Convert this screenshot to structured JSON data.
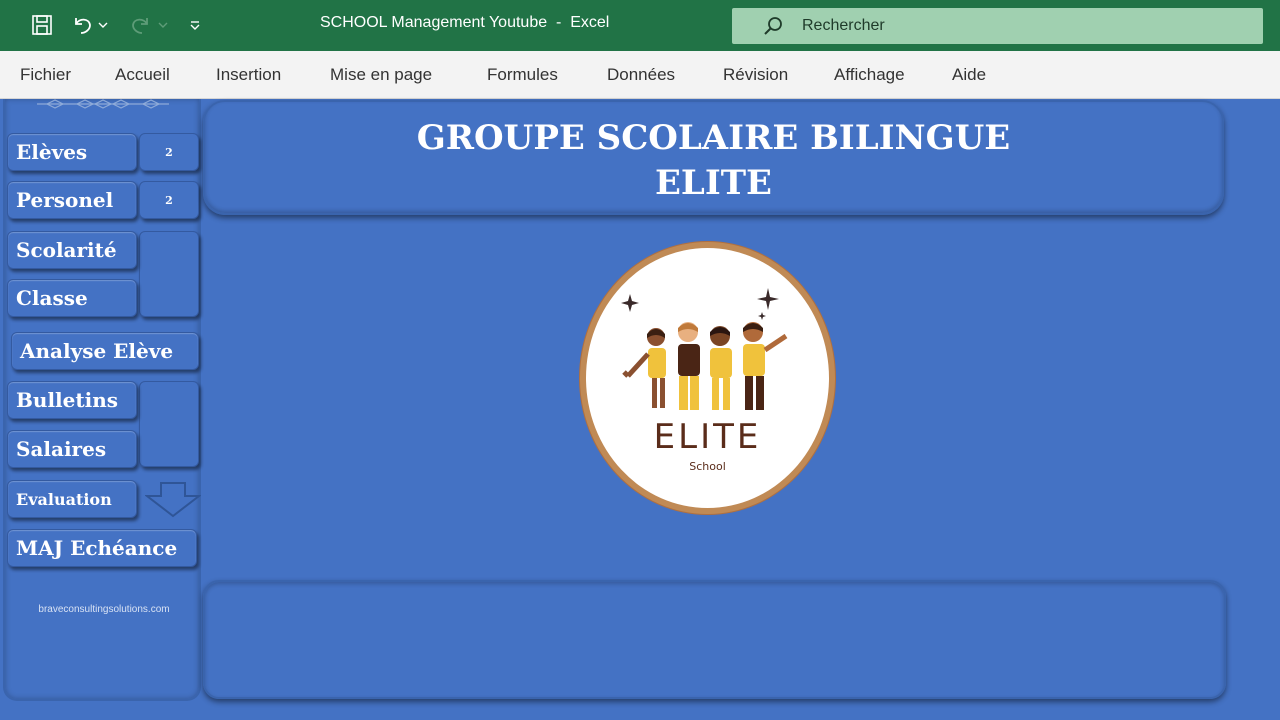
{
  "window": {
    "title": "SCHOOL Management Youtube  -  Excel",
    "search_placeholder": "Rechercher"
  },
  "quick_access": {
    "icons": [
      "save-icon",
      "undo-icon",
      "redo-icon",
      "customize-icon"
    ]
  },
  "ribbon": {
    "tabs": [
      "Fichier",
      "Accueil",
      "Insertion",
      "Mise en page",
      "Formules",
      "Données",
      "Révision",
      "Affichage",
      "Aide"
    ]
  },
  "sidebar": {
    "buttons": {
      "eleves": "Elèves",
      "personel": "Personel",
      "scolarite": "Scolarité",
      "classe": "Classe",
      "analyse": "Analyse Elève",
      "bulletins": "Bulletins",
      "salaires": "Salaires",
      "evaluation": "Evaluation",
      "maj": "MAJ Echéance"
    },
    "badges": {
      "eleves": "2",
      "personel": "2"
    },
    "footer": "braveconsultingsolutions.com"
  },
  "header": {
    "line1": "GROUPE SCOLAIRE BILINGUE",
    "line2": "ELITE"
  },
  "logo": {
    "name": "ELITE",
    "sub": "School"
  },
  "colors": {
    "excel_green": "#217346",
    "sheet_blue": "#4472c4",
    "search_bg": "#a0d0b0",
    "logo_ring": "#c08a55",
    "logo_text": "#5a2c1a"
  }
}
